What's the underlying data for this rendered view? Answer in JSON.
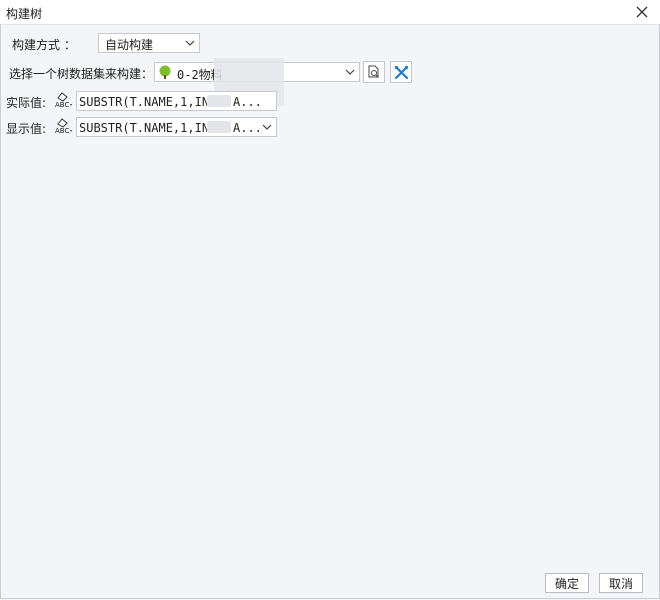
{
  "window": {
    "title": "构建树"
  },
  "form": {
    "build_mode_label": "构建方式 ：",
    "build_mode_value": "自动构建",
    "dataset_label": "选择一个树数据集来构建：",
    "dataset_value": "0-2物料",
    "actual_value_label": "实际值:",
    "actual_value_formula": "SUBSTR(T.NAME,1,INSTR",
    "actual_value_suffix": "A...",
    "display_value_label": "显示值:",
    "display_value_formula": "SUBSTR(T.NAME,1,INSTR",
    "display_value_suffix": "A..."
  },
  "footer": {
    "ok_label": "确定",
    "cancel_label": "取消"
  },
  "icons": {
    "close": "close-icon",
    "dropdown": "chevron-down-icon",
    "tree": "tree-icon",
    "preview": "preview-search-icon",
    "edit": "tools-icon",
    "abc": "abc-text-icon"
  },
  "colors": {
    "accent_blue": "#1e7ad6",
    "tree_green": "#7cbf2a",
    "background": "#f4f5f8"
  }
}
